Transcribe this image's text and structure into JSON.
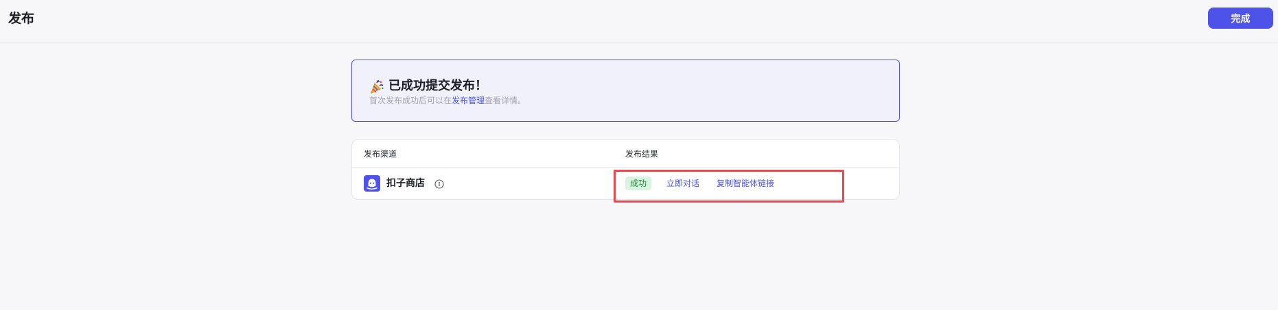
{
  "header": {
    "title": "发布",
    "done_label": "完成"
  },
  "banner": {
    "icon": "party-popper-icon",
    "title": "已成功提交发布！",
    "desc_before": "首次发布成功后可以在",
    "desc_link": "发布管理",
    "desc_after": "查看详情。"
  },
  "table": {
    "columns": [
      "发布渠道",
      "发布结果"
    ],
    "rows": [
      {
        "channel_icon": "coze-store-icon",
        "channel": "扣子商店",
        "info_icon": "info-icon",
        "status": "成功",
        "actions": [
          "立即对话",
          "复制智能体链接"
        ]
      }
    ]
  },
  "colors": {
    "accent": "#4d53e8",
    "success_bg": "#d9f4de",
    "success_text": "#1f8a3b",
    "highlight": "#e5484d",
    "page_bg": "#f7f7f9"
  }
}
